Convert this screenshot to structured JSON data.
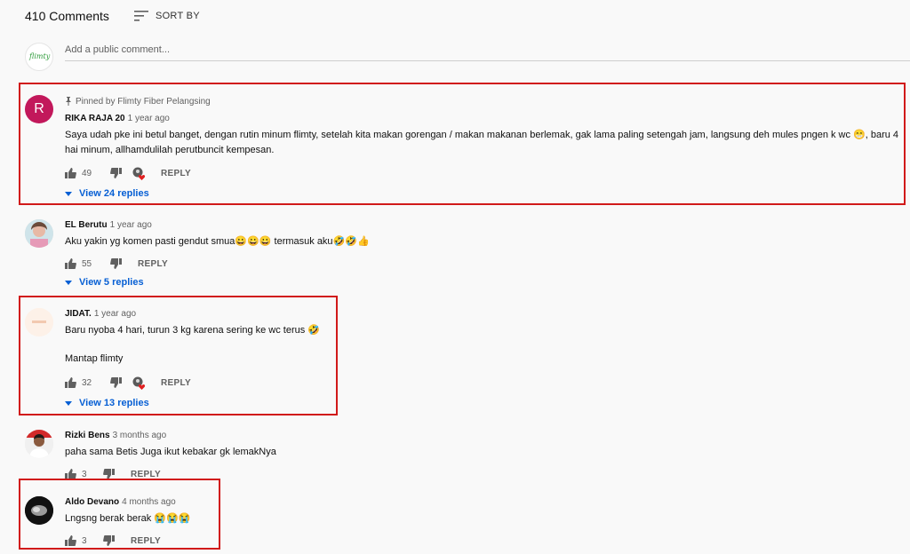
{
  "header": {
    "count": "410 Comments",
    "sort_label": "SORT BY"
  },
  "add_comment": {
    "placeholder": "Add a public comment...",
    "avatar_text": "flimty"
  },
  "comments": [
    {
      "pinned_label": "Pinned by Flimty Fiber Pelangsing",
      "avatar_letter": "R",
      "avatar_color": "#c2185b",
      "author": "RIKA RAJA 20",
      "time": "1 year ago",
      "text": "Saya udah pke ini betul banget, dengan rutin minum flimty, setelah kita makan gorengan / makan makanan berlemak, gak lama paling setengah jam, langsung deh mules pngen k wc 😁, baru 4 hai minum, allhamdulilah perutbuncit  kempesan.",
      "likes": "49",
      "reply_label": "REPLY",
      "view_replies": "View 24 replies"
    },
    {
      "author": "EL Berutu",
      "time": "1 year ago",
      "text": "Aku yakin yg komen pasti gendut smua😀😀😀 termasuk aku🤣🤣👍",
      "likes": "55",
      "reply_label": "REPLY",
      "view_replies": "View 5 replies"
    },
    {
      "author": "JIDAT.",
      "time": "1 year ago",
      "text": "Baru nyoba 4 hari, turun 3 kg karena sering ke wc terus 🤣",
      "text2": "Mantap flimty",
      "likes": "32",
      "reply_label": "REPLY",
      "view_replies": "View 13 replies"
    },
    {
      "author": "Rizki Bens",
      "time": "3 months ago",
      "text": "paha sama Betis Juga ikut kebakar gk lemakNya",
      "likes": "3",
      "reply_label": "REPLY"
    },
    {
      "author": "Aldo Devano",
      "time": "4 months ago",
      "text": "Lngsng berak berak 😭😭😭",
      "likes": "3",
      "reply_label": "REPLY"
    }
  ],
  "colors": {
    "link": "#065fd4",
    "highlight": "#d11a1a",
    "heart": "#e02020"
  }
}
